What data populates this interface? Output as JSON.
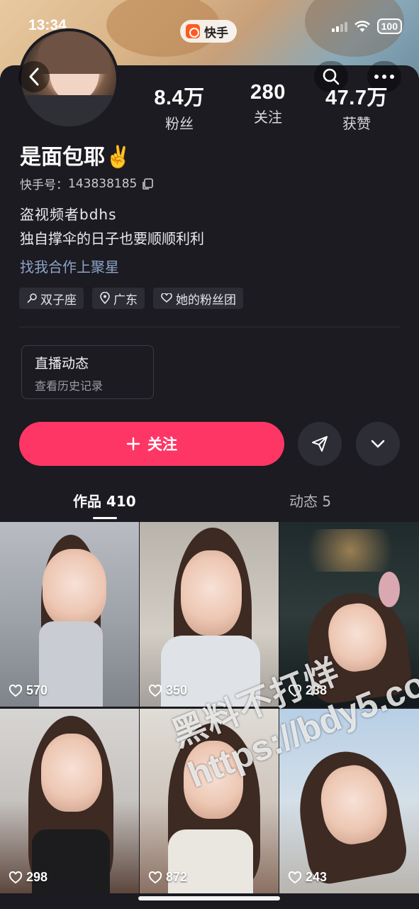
{
  "status_bar": {
    "time": "13:34",
    "app_name": "快手",
    "battery": "100"
  },
  "profile": {
    "name": "是面包耶✌️",
    "id_label": "快手号：",
    "id_value": "143838185",
    "bio_line1": "盗视频者bdhs",
    "bio_line2": "独自撑伞的日子也要顺顺利利",
    "cooperation_link": "找我合作上聚星"
  },
  "stats": [
    {
      "value": "8.4万",
      "label": "粉丝"
    },
    {
      "value": "280",
      "label": "关注"
    },
    {
      "value": "47.7万",
      "label": "获赞"
    }
  ],
  "tags": [
    {
      "icon": "zodiac-icon",
      "label": "双子座"
    },
    {
      "icon": "location-icon",
      "label": "广东"
    },
    {
      "icon": "fan-club-icon",
      "label": "她的粉丝团"
    }
  ],
  "live_card": {
    "title": "直播动态",
    "subtitle": "查看历史记录"
  },
  "actions": {
    "follow_label": "关注"
  },
  "tabs": [
    {
      "label": "作品 410",
      "active": true
    },
    {
      "label": "动态 5",
      "active": false
    }
  ],
  "videos": [
    {
      "likes": "570"
    },
    {
      "likes": "350"
    },
    {
      "likes": "238"
    },
    {
      "likes": "298"
    },
    {
      "likes": "872"
    },
    {
      "likes": "243"
    }
  ],
  "watermark": {
    "line1": "黑料不打烊",
    "line2": "https://bdy5.co"
  },
  "colors": {
    "accent": "#fe3666",
    "background": "#1b1b21",
    "link": "#8fa3c9"
  }
}
